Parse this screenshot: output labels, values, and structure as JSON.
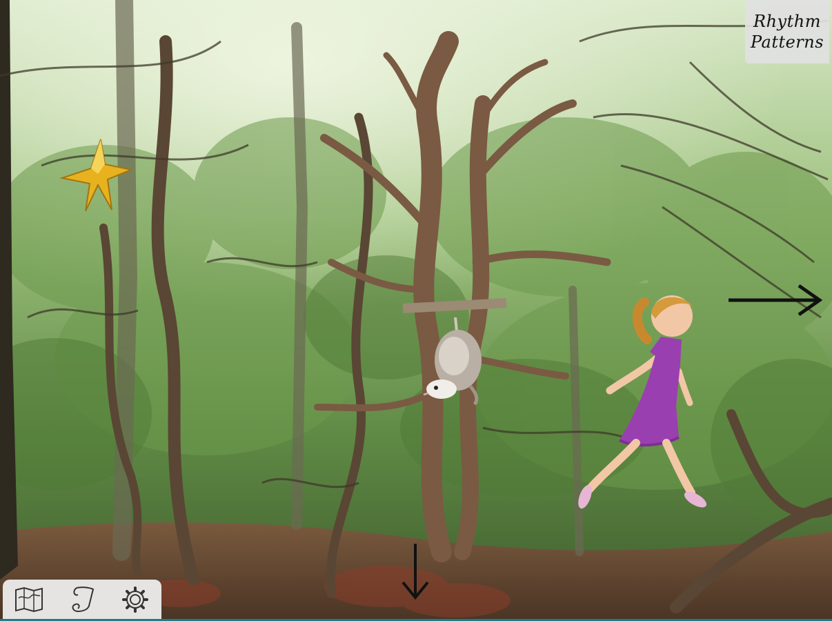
{
  "title_button": {
    "line1": "Rhythm",
    "line2": "Patterns"
  },
  "toolbar": {
    "icons": [
      "map-icon",
      "scroll-icon",
      "gear-icon"
    ]
  },
  "scene": {
    "characters": [
      "girl-in-purple-dress",
      "hanging-opossum"
    ],
    "collectibles": [
      "gold-star"
    ],
    "navigation": [
      "arrow-right",
      "arrow-down"
    ]
  },
  "colors": {
    "star": "#e8b21e",
    "dress": "#9a3fb0",
    "accent_bar": "#1a7e86"
  }
}
